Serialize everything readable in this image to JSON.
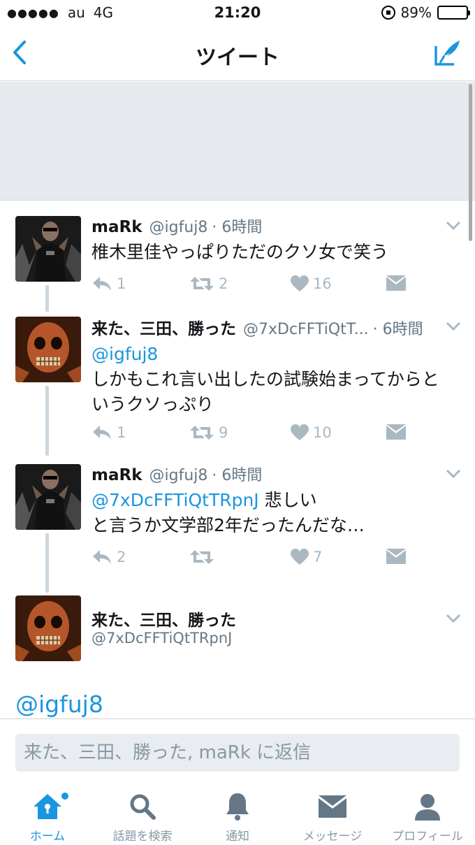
{
  "status_bar": {
    "signal": "●●●●●",
    "carrier": "au",
    "network": "4G",
    "time": "21:20",
    "battery": "89%",
    "battery_level": 0.89
  },
  "nav": {
    "title": "ツイート",
    "back_icon": "chevron-left-icon",
    "compose_icon": "compose-tweet-icon"
  },
  "tweets": [
    {
      "name": "maRk",
      "handle": "@igfuj8",
      "time": "· 6時間",
      "text": "椎木里佳やっぱりただのクソ女で笑う",
      "mention": "",
      "reply_count": "1",
      "retweet_count": "2",
      "like_count": "16"
    },
    {
      "name": "来た、三田、勝った",
      "handle": "@7xDcFFTiQtT...",
      "time": "· 6時間",
      "mention": "@igfuj8",
      "text": "しかもこれ言い出したの試験始まってからというクソっぷり",
      "reply_count": "1",
      "retweet_count": "9",
      "like_count": "10"
    },
    {
      "name": "maRk",
      "handle": "@igfuj8",
      "time": "· 6時間",
      "mention": "@7xDcFFTiQtTRpnJ",
      "text": "悲しい",
      "text2": "と言うか文学部2年だったんだな…",
      "reply_count": "2",
      "retweet_count": "",
      "like_count": "7"
    }
  ],
  "focus_tweet": {
    "name": "来た、三田、勝った",
    "handle": "@7xDcFFTiQtTRpnJ",
    "text": "@igfuj8"
  },
  "reply": {
    "placeholder": "来た、三田、勝った, maRk に返信"
  },
  "tabs": [
    {
      "label": "ホーム",
      "icon": "home-icon",
      "active": true
    },
    {
      "label": "話題を検索",
      "icon": "search-icon",
      "active": false
    },
    {
      "label": "通知",
      "icon": "bell-icon",
      "active": false
    },
    {
      "label": "メッセージ",
      "icon": "envelope-icon",
      "active": false
    },
    {
      "label": "プロフィール",
      "icon": "person-icon",
      "active": false
    }
  ],
  "colors": {
    "accent": "#1b95e0",
    "muted": "#aab8c2",
    "banner": "#e6e9ed"
  }
}
